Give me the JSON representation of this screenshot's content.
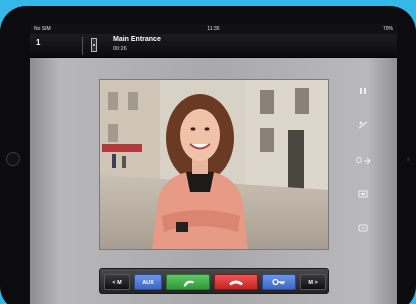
{
  "status": {
    "carrier": "No SIM",
    "time": "11:35",
    "battery": "70%"
  },
  "call": {
    "line": "1",
    "name": "Main Entrance",
    "duration": "00:26"
  },
  "side": {
    "volume": "))",
    "privacy": "☉"
  },
  "bottom": {
    "prev": "< M",
    "aux": "AUX",
    "next": "M >"
  },
  "colors": {
    "background": "#35b8e8",
    "answer": "#3aa844",
    "hangup": "#d63a3a",
    "blue_button": "#4b76d6"
  },
  "icons": {
    "answer": "phone-icon",
    "hangup": "hangup-icon",
    "unlock": "key-icon"
  }
}
